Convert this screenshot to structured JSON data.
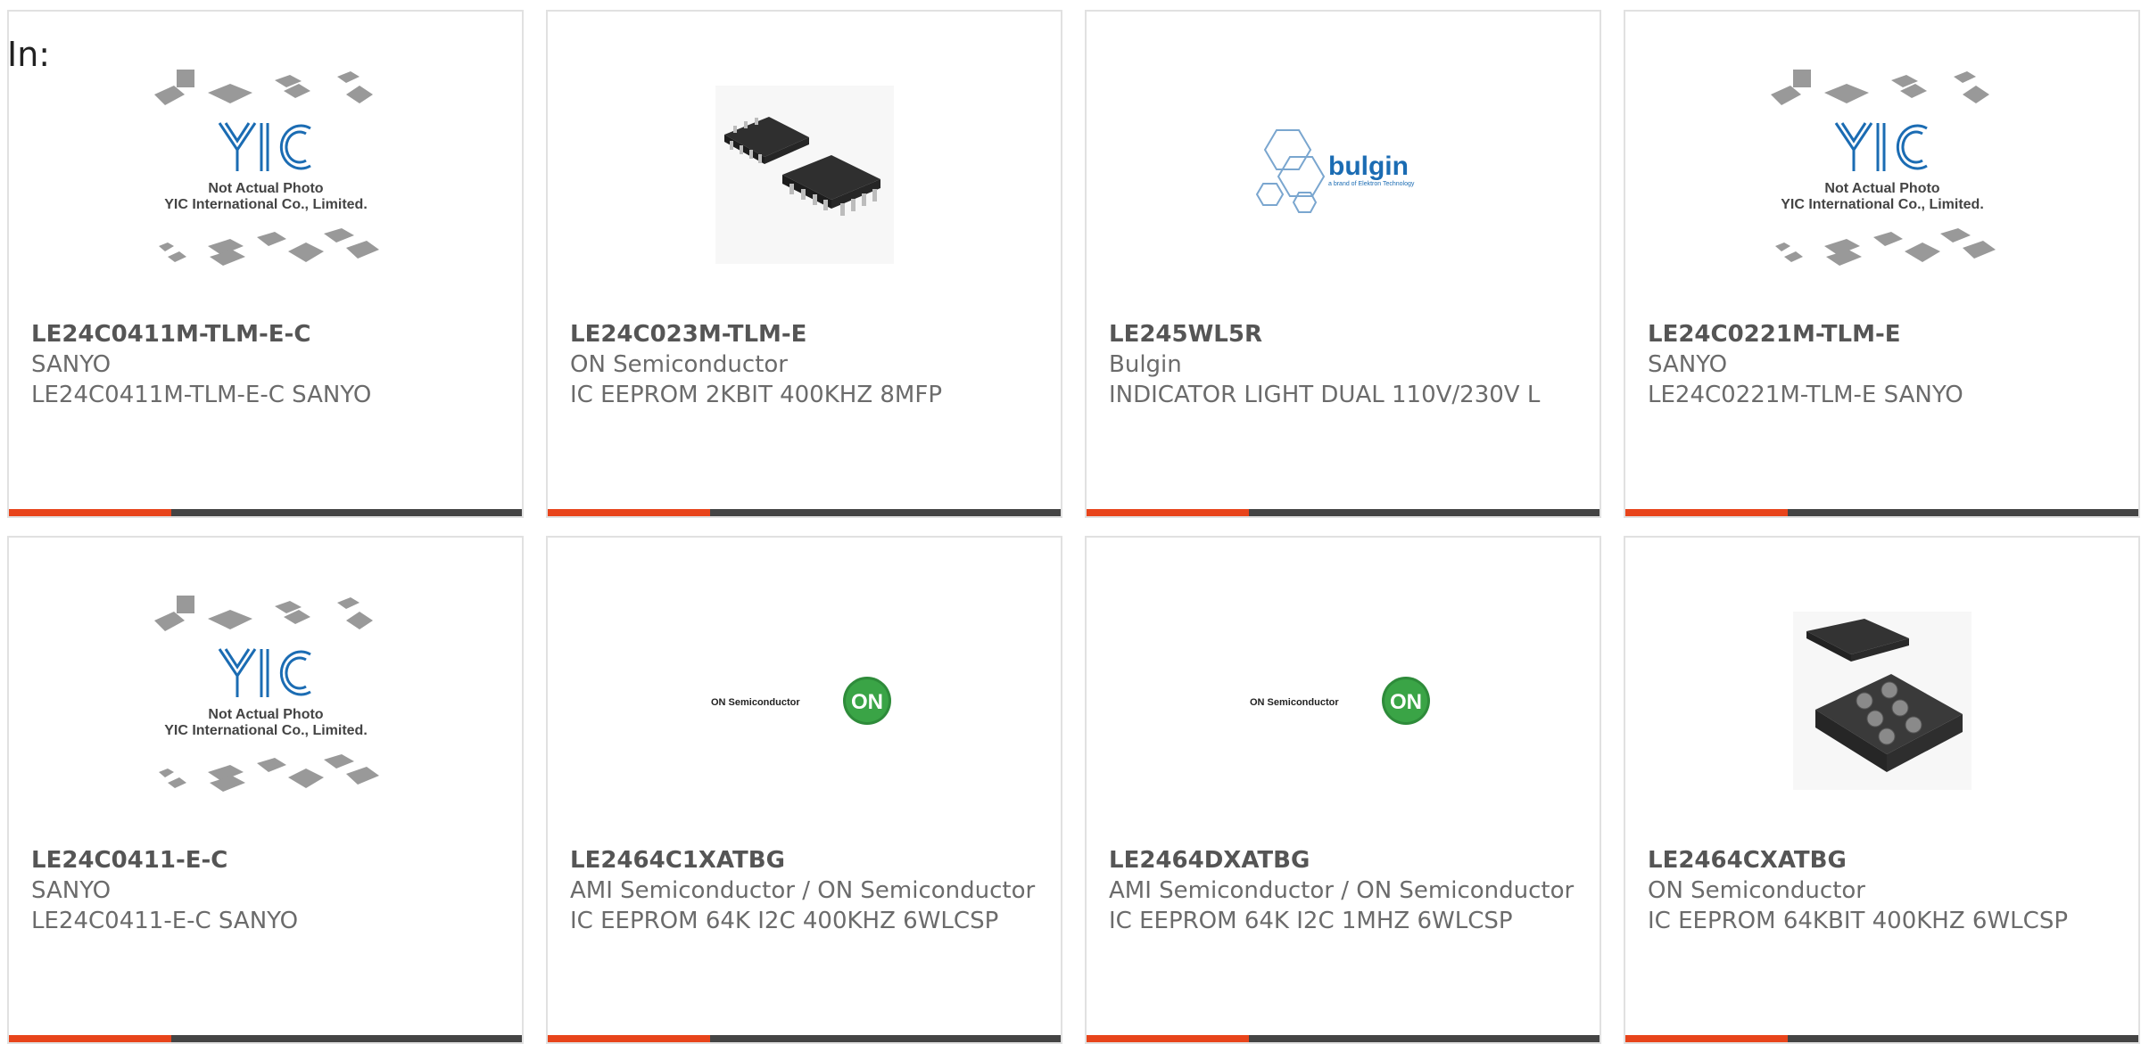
{
  "label": "In:",
  "colors": {
    "accent": "#e8441b",
    "bar": "#444444",
    "border": "#e1e1e1",
    "text": "#6b6b6b"
  },
  "placeholder": {
    "line1": "Not Actual Photo",
    "line2": "YIC International Co., Limited.",
    "logo": "YIC"
  },
  "logos": {
    "bulgin_name": "bulgin",
    "bulgin_sub": "a brand of Elektron Technology",
    "on_text": "ON Semiconductor",
    "on_badge": "ON"
  },
  "products": [
    {
      "part": "LE24C0411M-TLM-E-C",
      "maker": "SANYO",
      "desc": "LE24C0411M-TLM-E-C SANYO",
      "image": "yic-placeholder-icon"
    },
    {
      "part": "LE24C023M-TLM-E",
      "maker": "ON Semiconductor",
      "desc": "IC EEPROM 2KBIT 400KHZ 8MFP",
      "image": "soic-chip-icon"
    },
    {
      "part": "LE245WL5R",
      "maker": "Bulgin",
      "desc": "INDICATOR LIGHT DUAL 110V/230V L",
      "image": "bulgin-logo-icon"
    },
    {
      "part": "LE24C0221M-TLM-E",
      "maker": "SANYO",
      "desc": "LE24C0221M-TLM-E SANYO",
      "image": "yic-placeholder-icon"
    },
    {
      "part": "LE24C0411-E-C",
      "maker": "SANYO",
      "desc": "LE24C0411-E-C SANYO",
      "image": "yic-placeholder-icon"
    },
    {
      "part": "LE2464C1XATBG",
      "maker": "AMI Semiconductor / ON Semiconductor",
      "desc": "IC EEPROM 64K I2C 400KHZ 6WLCSP",
      "image": "on-semi-logo-icon"
    },
    {
      "part": "LE2464DXATBG",
      "maker": "AMI Semiconductor / ON Semiconductor",
      "desc": "IC EEPROM 64K I2C 1MHZ 6WLCSP",
      "image": "on-semi-logo-icon"
    },
    {
      "part": "LE2464CXATBG",
      "maker": "ON Semiconductor",
      "desc": "IC EEPROM 64KBIT 400KHZ 6WLCSP",
      "image": "wlcsp-chip-icon"
    }
  ]
}
